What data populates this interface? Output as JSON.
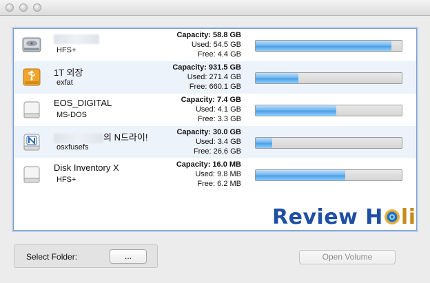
{
  "window": {
    "title": ""
  },
  "volumes": [
    {
      "name": "",
      "filesystem": "HFS+",
      "capacity": "Capacity: 58.8 GB",
      "used": "Used: 54.5 GB",
      "free": "Free: 4.4 GB",
      "usage_fraction": 0.927,
      "icon": "hard-drive-icon"
    },
    {
      "name": "1T 외장",
      "filesystem": "exfat",
      "capacity": "Capacity: 931.5 GB",
      "used": "Used: 271.4 GB",
      "free": "Free: 660.1 GB",
      "usage_fraction": 0.291,
      "icon": "usb-drive-icon"
    },
    {
      "name": "EOS_DIGITAL",
      "filesystem": "MS-DOS",
      "capacity": "Capacity: 7.4 GB",
      "used": "Used: 4.1 GB",
      "free": "Free: 3.3 GB",
      "usage_fraction": 0.554,
      "icon": "external-disk-icon"
    },
    {
      "name": "의 N드라이!",
      "filesystem": "osxfusefs",
      "capacity": "Capacity: 30.0 GB",
      "used": "Used: 3.4 GB",
      "free": "Free: 26.6 GB",
      "usage_fraction": 0.113,
      "icon": "ndrive-icon"
    },
    {
      "name": "Disk Inventory X",
      "filesystem": "HFS+",
      "capacity": "Capacity: 16.0 MB",
      "used": "Used: 9.8 MB",
      "free": "Free: 6.2 MB",
      "usage_fraction": 0.613,
      "icon": "external-disk-icon"
    }
  ],
  "watermark": {
    "part1": "Review H",
    "part2": "lic"
  },
  "folder": {
    "label": "Select Folder:",
    "browse_label": "..."
  },
  "open_volume_label": "Open Volume",
  "colors": {
    "selection_border": "#7fa0c9",
    "bar_fill": "#4d9fe6",
    "watermark_blue": "#1f4fa3",
    "watermark_gold": "#c98a1b"
  }
}
